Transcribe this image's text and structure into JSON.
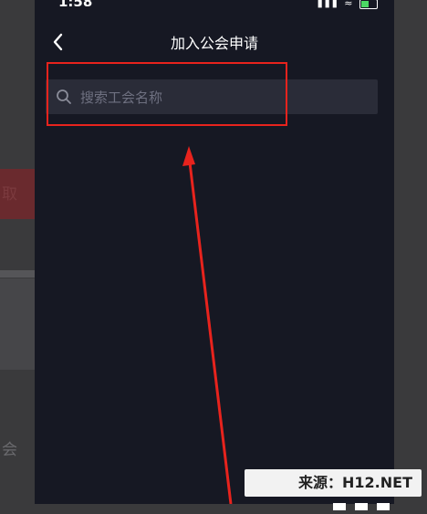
{
  "status_bar": {
    "time": "1:58",
    "signal": "▮▮▮",
    "wifi": "≈"
  },
  "header": {
    "title": "加入公会申请"
  },
  "search": {
    "placeholder": "搜索工会名称",
    "value": ""
  },
  "background": {
    "left_label_1": "取",
    "left_label_2": "会"
  },
  "watermark": {
    "text": "来源：H12.NET"
  },
  "colors": {
    "panel_bg": "#161823",
    "search_bg": "#2a2c38",
    "annotation": "#e8231d"
  }
}
